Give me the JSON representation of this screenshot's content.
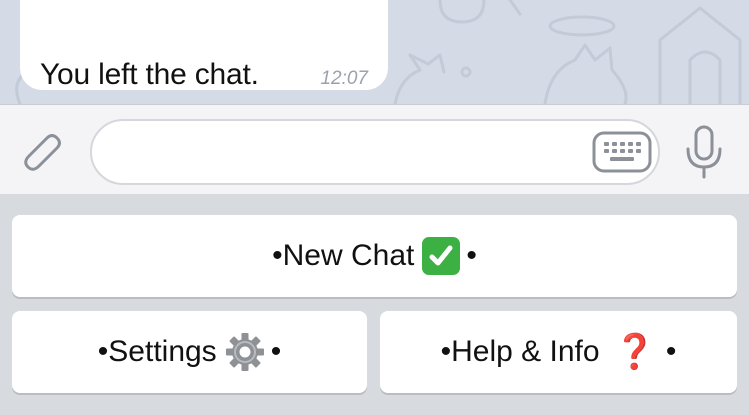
{
  "message": {
    "text": "You left the chat.",
    "time": "12:07"
  },
  "composer": {
    "placeholder": "",
    "attach_icon": "paperclip-icon",
    "keyboard_icon": "keyboard-icon",
    "mic_icon": "microphone-icon"
  },
  "bot_keyboard": {
    "new_chat": {
      "prefix": "•New Chat",
      "suffix": "•",
      "emoji": "check-mark-button-icon"
    },
    "settings": {
      "prefix": "•Settings",
      "suffix": "•",
      "emoji": "gear-icon"
    },
    "help": {
      "prefix": "•Help & Info",
      "suffix": "•",
      "emoji": "question-mark-icon",
      "glyph": "❓"
    }
  },
  "colors": {
    "chat_background": "#d4dbe6",
    "bubble": "#ffffff",
    "keyboard_background": "#d7dade",
    "check_green": "#3cb043",
    "question_red": "#d8252c"
  }
}
